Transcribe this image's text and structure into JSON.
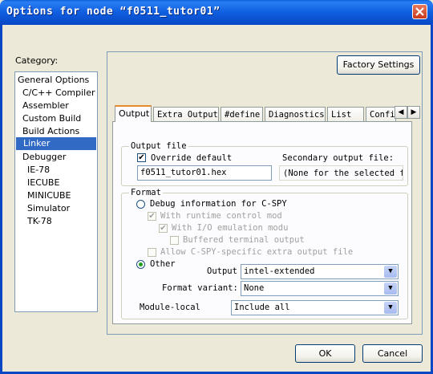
{
  "window": {
    "title": "Options for node “f0511_tutor01”"
  },
  "category": {
    "label": "Category:",
    "items": [
      "General Options",
      "C/C++ Compiler",
      "Assembler",
      "Custom Build",
      "Build Actions",
      "Linker",
      "Debugger",
      "IE-78",
      "IECUBE",
      "MINICUBE",
      "Simulator",
      "TK-78"
    ],
    "selected": "Linker"
  },
  "factory_settings_label": "Factory Settings",
  "tabs": [
    "Output",
    "Extra Output",
    "#define",
    "Diagnostics",
    "List",
    "Config"
  ],
  "active_tab": "Output",
  "output_file": {
    "group_label": "Output file",
    "override_label": "Override default",
    "override_checked": true,
    "filename": "f0511_tutor01.hex",
    "secondary_label": "Secondary output file:",
    "secondary_value": "(None for the selected format)"
  },
  "format": {
    "group_label": "Format",
    "debug_label": "Debug information for C-SPY",
    "runtime_label": "With runtime control mod",
    "io_label": "With I/O emulation modu",
    "buffered_label": "Buffered terminal output",
    "allow_label": "Allow C-SPY-specific extra output file",
    "other_label": "Other",
    "output_label": "Output",
    "output_value": "intel-extended",
    "variant_label": "Format variant:",
    "variant_value": "None",
    "module_label": "Module-local",
    "module_value": "Include all"
  },
  "ok_label": "OK",
  "cancel_label": "Cancel"
}
